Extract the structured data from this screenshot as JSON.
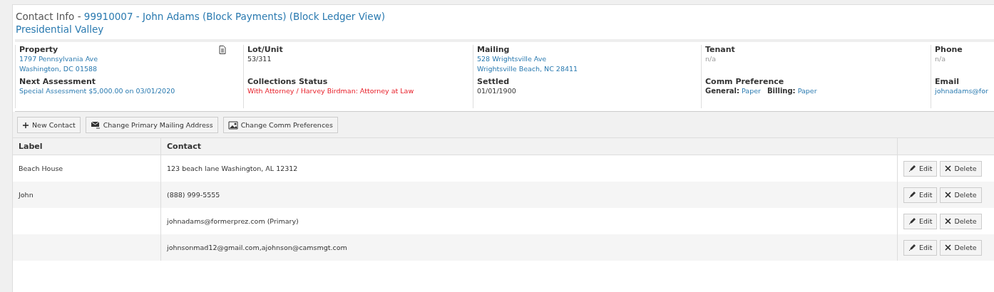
{
  "header": {
    "prefix": "Contact Info - ",
    "title": "99910007 - John Adams (Block Payments) (Block Ledger View)",
    "subtitle": "Presidential Valley"
  },
  "info": [
    {
      "label": "Property",
      "kind": "link",
      "lines": [
        "1797 Pennsylvania Ave",
        "Washington, DC 01588"
      ],
      "doc_icon": true
    },
    {
      "label": "Lot/Unit",
      "kind": "plain",
      "lines": [
        "53/311"
      ]
    },
    {
      "label": "Mailing",
      "kind": "link",
      "lines": [
        "528 Wrightsville Ave",
        "Wrightsville Beach, NC 28411"
      ]
    },
    {
      "label": "Tenant",
      "kind": "muted",
      "lines": [
        "n/a"
      ]
    },
    {
      "label": "Phone",
      "kind": "muted",
      "lines": [
        "n/a"
      ]
    },
    {
      "label": "Next Assessment",
      "kind": "link",
      "lines": [
        "Special Assessment $5,000.00 on 03/01/2020"
      ]
    },
    {
      "label": "Collections Status",
      "kind": "alert",
      "lines": [
        "With Attorney  / Harvey Birdman: Attorney at Law"
      ]
    },
    {
      "label": "Settled",
      "kind": "plain",
      "lines": [
        "01/01/1900"
      ]
    },
    {
      "label": "Comm Preference",
      "kind": "pairs",
      "pairs": [
        {
          "key": "General:",
          "value": "Paper"
        },
        {
          "key": "Billing:",
          "value": "Paper"
        }
      ]
    },
    {
      "label": "Email",
      "kind": "link",
      "lines": [
        "johnadams@for"
      ]
    }
  ],
  "toolbar": [
    {
      "label": "New Contact"
    },
    {
      "label": "Change Primary Mailing Address"
    },
    {
      "label": "Change Comm Preferences"
    }
  ],
  "table": {
    "columns": [
      "Label",
      "Contact"
    ],
    "rows": [
      {
        "label": "Beach House",
        "contact": "123 beach lane Washington, AL 12312",
        "actions": [
          "Edit",
          "Delete"
        ]
      },
      {
        "label": "John",
        "contact": "(888) 999-5555",
        "actions": [
          "Edit",
          "Delete"
        ]
      },
      {
        "contact": "johnadams@formerprez.com (Primary)",
        "actions": [
          "Edit",
          "Delete"
        ]
      },
      {
        "contact": "johnsonmad12@gmail.com,ajohnson@camsmgt.com",
        "actions": [
          "Edit",
          "Delete"
        ]
      }
    ]
  }
}
